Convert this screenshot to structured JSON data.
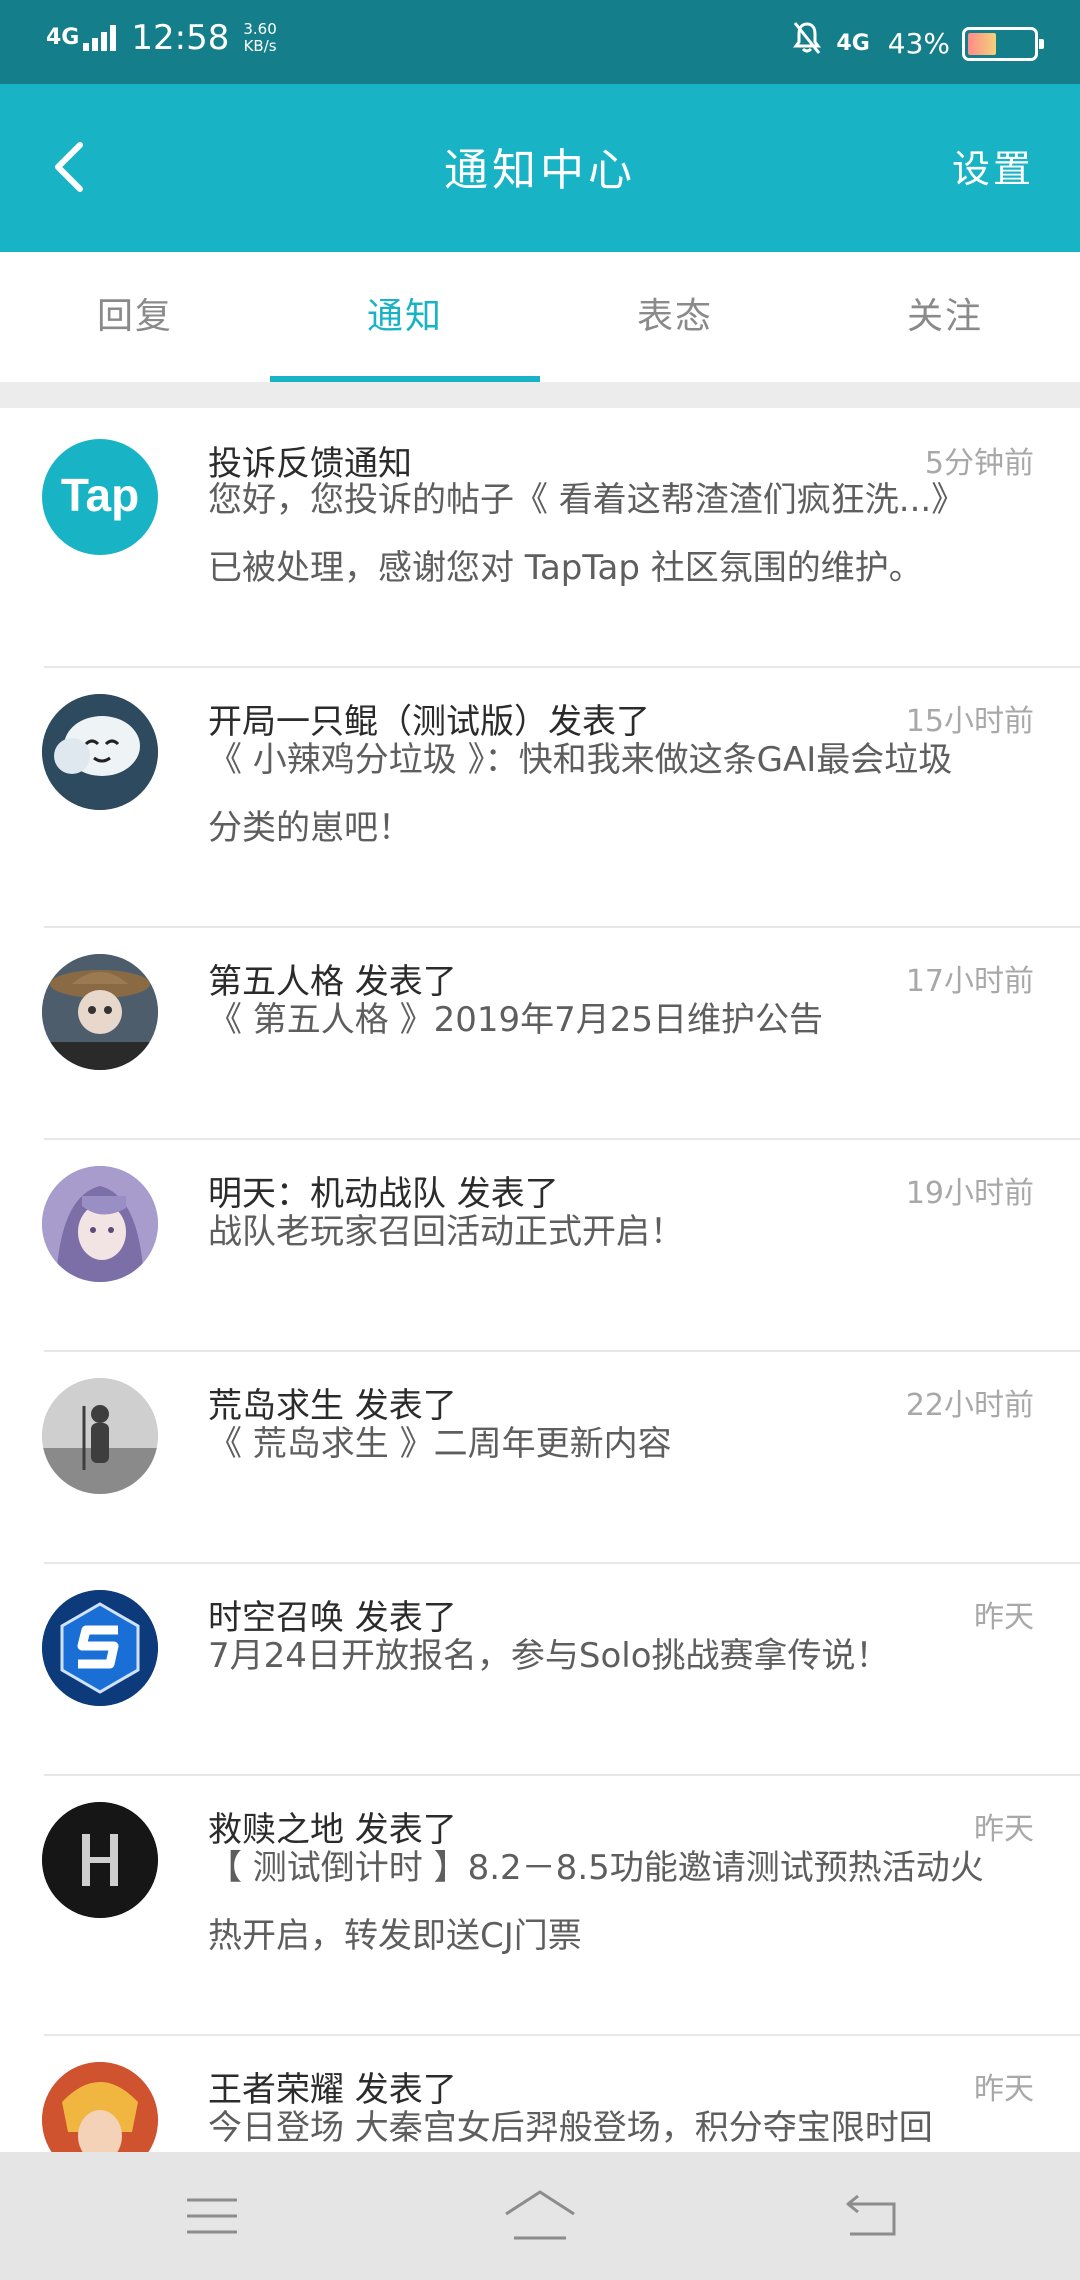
{
  "status_bar": {
    "network_left": "4G",
    "time": "12:58",
    "speed_value": "3.60",
    "speed_unit": "KB/s",
    "network_right": "4G",
    "battery_percent": "43%",
    "battery_level": 0.43
  },
  "header": {
    "title": "通知中心",
    "settings_label": "设置",
    "back_icon": "chevron-left-icon",
    "color": "#18b4c5"
  },
  "tabs": [
    {
      "label": "回复",
      "active": false
    },
    {
      "label": "通知",
      "active": true
    },
    {
      "label": "表态",
      "active": false
    },
    {
      "label": "关注",
      "active": false
    }
  ],
  "notifications": [
    {
      "avatar": "taptap-logo",
      "title": "投诉反馈通知",
      "time": "5分钟前",
      "body": "您好，您投诉的帖子《 看着这帮渣渣们疯狂洗...》\n已被处理，感谢您对 TapTap 社区氛围的维护。"
    },
    {
      "avatar": "cartoon-avatar",
      "title": "开局一只鲲（测试版）发表了",
      "time": "15小时前",
      "body": "《 小辣鸡分垃圾 》：快和我来做这条GAI最会垃圾\n分类的崽吧！"
    },
    {
      "avatar": "identity-v-avatar",
      "title": "第五人格 发表了",
      "time": "17小时前",
      "body": "《 第五人格 》2019年7月25日维护公告"
    },
    {
      "avatar": "anime-girl-avatar",
      "title": "明天：机动战队 发表了",
      "time": "19小时前",
      "body": "战队老玩家召回活动正式开启！"
    },
    {
      "avatar": "survivor-avatar",
      "title": "荒岛求生 发表了",
      "time": "22小时前",
      "body": "《 荒岛求生 》二周年更新内容"
    },
    {
      "avatar": "s-logo-avatar",
      "title": "时空召唤 发表了",
      "time": "昨天",
      "body": "7月24日开放报名，参与Solo挑战赛拿传说！"
    },
    {
      "avatar": "h-logo-avatar",
      "title": "救赎之地 发表了",
      "time": "昨天",
      "body": "【 测试倒计时 】8.2－8.5功能邀请测试预热活动火\n热开启，转发即送CJ门票"
    },
    {
      "avatar": "hero-avatar",
      "title": "王者荣耀 发表了",
      "time": "昨天",
      "body": "今日登场 大秦宫女后羿般登场，积分夺宝限时回"
    }
  ],
  "nav_bar": {
    "menu_icon": "menu-icon",
    "home_icon": "home-icon",
    "back_icon": "back-arrow-icon"
  }
}
